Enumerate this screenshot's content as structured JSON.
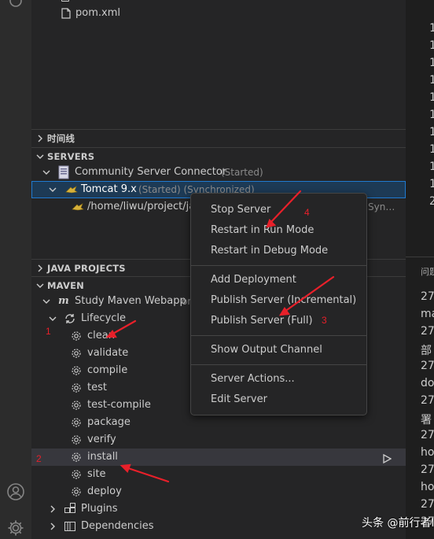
{
  "explorer": {
    "pom_file": "pom.xml"
  },
  "sections": {
    "timeline": "时间线",
    "servers": "SERVERS",
    "java_projects": "JAVA PROJECTS",
    "maven": "MAVEN"
  },
  "servers": {
    "connector": {
      "name": "Community Server Connector",
      "status": "(Started)"
    },
    "tomcat": {
      "name": "Tomcat 9.x",
      "status": "(Started) (Synchronized)"
    },
    "deployment": {
      "path": "/home/liwu/project/ja",
      "status": "Syn…"
    }
  },
  "maven": {
    "project": {
      "name": "Study Maven Webapp",
      "suffix": "or"
    },
    "lifecycle_label": "Lifecycle",
    "phases": [
      "clean",
      "validate",
      "compile",
      "test",
      "test-compile",
      "package",
      "verify",
      "install",
      "site",
      "deploy"
    ],
    "plugins_label": "Plugins",
    "dependencies_label": "Dependencies"
  },
  "context_menu": {
    "group1": [
      "Stop Server",
      "Restart in Run Mode",
      "Restart in Debug Mode"
    ],
    "group2": [
      "Add Deployment",
      "Publish Server (Incremental)",
      "Publish Server (Full)"
    ],
    "group3": [
      "Show Output Channel"
    ],
    "group4": [
      "Server Actions...",
      "Edit Server"
    ]
  },
  "annotations": {
    "n1": "1",
    "n2": "2",
    "n3": "3",
    "n4": "4"
  },
  "editor": {
    "line_digits": [
      "1",
      "1",
      "1",
      "1",
      "1",
      "1",
      "1",
      "1",
      "1",
      "1",
      "2"
    ]
  },
  "panel": {
    "title": "问题",
    "lines": [
      "27",
      "ma",
      "27",
      "部",
      "27",
      "do",
      "27",
      "署",
      "27",
      "ho",
      "27",
      "ho",
      "27",
      "27"
    ]
  },
  "watermark": "头条 @前行者lw",
  "colors": {
    "selection_border": "#1f7ad1",
    "annotation": "#e8202a",
    "menu_bg": "#252526"
  }
}
